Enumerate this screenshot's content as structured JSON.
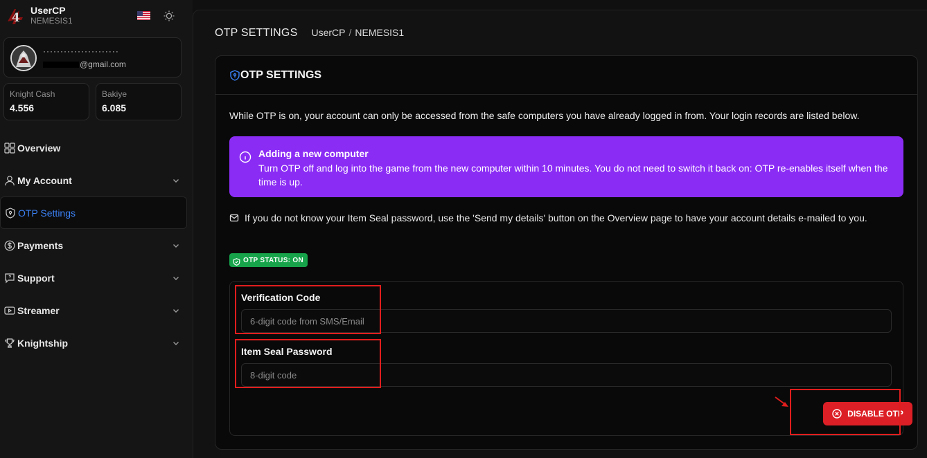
{
  "brand": {
    "title": "UserCP",
    "subtitle": "NEMESIS1",
    "logo_text": "4"
  },
  "user": {
    "name_masked": "······················",
    "email_suffix": "@gmail.com"
  },
  "stats": [
    {
      "label": "Knight Cash",
      "value": "4.556"
    },
    {
      "label": "Bakiye",
      "value": "6.085"
    }
  ],
  "nav": [
    {
      "label": "Overview",
      "icon": "grid-icon",
      "has_chevron": false,
      "active": false
    },
    {
      "label": "My Account",
      "icon": "user-icon",
      "has_chevron": true,
      "active": false
    },
    {
      "label": "OTP Settings",
      "icon": "shield-icon",
      "has_chevron": false,
      "active": true
    },
    {
      "label": "Payments",
      "icon": "dollar-icon",
      "has_chevron": true,
      "active": false
    },
    {
      "label": "Support",
      "icon": "chat-icon",
      "has_chevron": true,
      "active": false
    },
    {
      "label": "Streamer",
      "icon": "video-icon",
      "has_chevron": true,
      "active": false
    },
    {
      "label": "Knightship",
      "icon": "trophy-icon",
      "has_chevron": true,
      "active": false
    }
  ],
  "header": {
    "title": "OTP SETTINGS",
    "breadcrumb": [
      "UserCP",
      "NEMESIS1"
    ],
    "breadcrumb_sep": "/"
  },
  "card": {
    "title": "OTP SETTINGS",
    "intro": "While OTP is on, your account can only be accessed from the safe computers you have already logged in from. Your login records are listed below.",
    "alert": {
      "title": "Adding a new computer",
      "body": "Turn OTP off and log into the game from the new computer within 10 minutes. You do not need to switch it back on: OTP re-enables itself when the time is up."
    },
    "note": "If you do not know your Item Seal password, use the 'Send my details' button on the Overview page to have your account details e-mailed to you.",
    "status_badge": "OTP STATUS: ON"
  },
  "form": {
    "verification": {
      "label": "Verification Code",
      "placeholder": "6-digit code from SMS/Email"
    },
    "item_seal": {
      "label": "Item Seal Password",
      "placeholder": "8-digit code"
    },
    "submit_label": "DISABLE OTP"
  },
  "colors": {
    "accent_blue": "#3b82f6",
    "alert_purple": "#8b2cf5",
    "status_green": "#16a34a",
    "danger_red": "#dc1f26",
    "highlight_red": "#e11d1d"
  }
}
